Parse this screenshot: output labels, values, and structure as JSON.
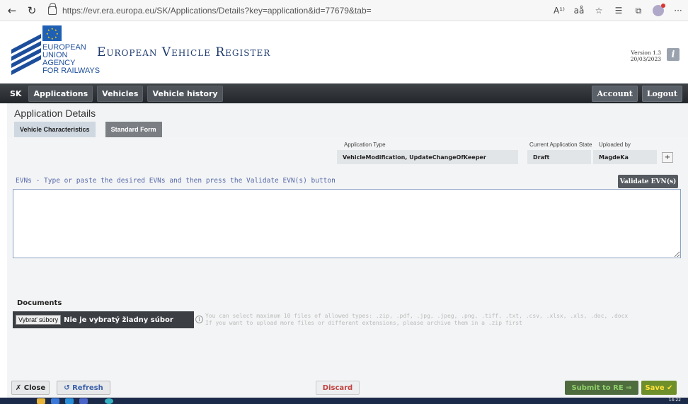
{
  "browser": {
    "back_icon": "back-arrow-icon",
    "reload_icon": "reload-icon",
    "url": "https://evr.era.europa.eu/SK/Applications/Details?key=application&id=77679&tab=",
    "read_aloud": "A¹⁾",
    "immersive": "aå"
  },
  "header": {
    "agency_lines": [
      "EUROPEAN",
      "UNION",
      "AGENCY",
      "FOR RAILWAYS"
    ],
    "app_title": "European Vehicle Register",
    "version_label": "Version 1.3",
    "version_date": "20/03/2023",
    "info_label": "i"
  },
  "nav": {
    "country": "SK",
    "items": [
      "Applications",
      "Vehicles",
      "Vehicle history"
    ],
    "account": "Account",
    "logout": "Logout"
  },
  "page": {
    "title": "Application Details",
    "tabs": [
      {
        "label": "Vehicle Characteristics",
        "active": true
      },
      {
        "label": "Standard Form",
        "active": false
      }
    ]
  },
  "application": {
    "type_label": "Application Type",
    "type_value": "VehicleModification, UpdateChangeOfKeeper",
    "state_label": "Current Application State",
    "state_value": "Draft",
    "uploaded_label": "Uploaded by",
    "uploaded_value": "MagdeKa",
    "plus_label": "+"
  },
  "evn": {
    "instruction": "EVNs - Type or paste the desired EVNs and then press the Validate EVN(s) button",
    "validate_label": "Validate EVN(s)",
    "value": ""
  },
  "documents": {
    "label": "Documents",
    "choose_button": "Vybrať súbory",
    "status": "Nie je vybratý žiadny súbor",
    "help_line1": "You can select maximum 10 files of allowed types: .zip, .pdf, .jpg, .jpeg, .png, .tiff, .txt, .csv, .xlsx, .xls, .doc, .docx",
    "help_line2": "If you want to upload more files or different extensions, please archive them in a .zip first"
  },
  "footer": {
    "close": "✗ Close",
    "refresh": "↺ Refresh",
    "discard": "Discard",
    "submit": "Submit to RE ⇒",
    "save": "Save ✔"
  },
  "taskbar": {
    "time": "14:22"
  }
}
